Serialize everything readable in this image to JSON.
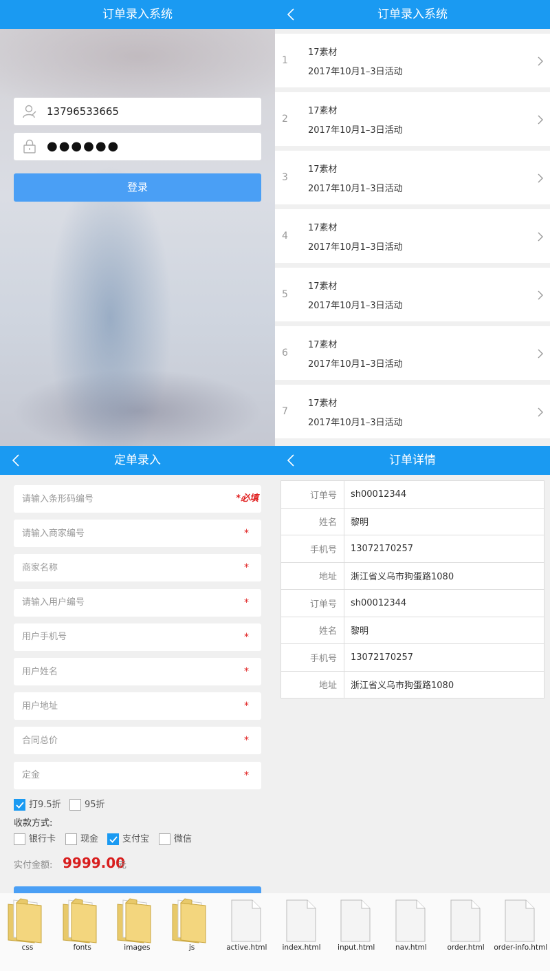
{
  "login": {
    "title": "订单录入系统",
    "phone": "13796533665",
    "password_mask": "●●●●●●",
    "login_button": "登录"
  },
  "list": {
    "title": "订单录入系统",
    "items": [
      {
        "num": "1",
        "title": "17素材",
        "sub": "2017年10月1–3日活动"
      },
      {
        "num": "2",
        "title": "17素材",
        "sub": "2017年10月1–3日活动"
      },
      {
        "num": "3",
        "title": "17素材",
        "sub": "2017年10月1–3日活动"
      },
      {
        "num": "4",
        "title": "17素材",
        "sub": "2017年10月1–3日活动"
      },
      {
        "num": "5",
        "title": "17素材",
        "sub": "2017年10月1–3日活动"
      },
      {
        "num": "6",
        "title": "17素材",
        "sub": "2017年10月1–3日活动"
      },
      {
        "num": "7",
        "title": "17素材",
        "sub": "2017年10月1–3日活动"
      }
    ]
  },
  "input": {
    "title": "定单录入",
    "fields": [
      {
        "placeholder": "请输入条形码编号",
        "mark": "*必填"
      },
      {
        "placeholder": "请输入商家编号",
        "mark": "*"
      },
      {
        "placeholder": "商家名称",
        "mark": "*"
      },
      {
        "placeholder": "请输入用户编号",
        "mark": "*"
      },
      {
        "placeholder": "用户手机号",
        "mark": "*"
      },
      {
        "placeholder": "用户姓名",
        "mark": "*"
      },
      {
        "placeholder": "用户地址",
        "mark": "*"
      },
      {
        "placeholder": "合同总价",
        "mark": "*"
      },
      {
        "placeholder": "定金",
        "mark": "*"
      }
    ],
    "discounts": [
      {
        "label": "打9.5折",
        "checked": true
      },
      {
        "label": "95折",
        "checked": false
      }
    ],
    "payment_label": "收款方式:",
    "payments": [
      {
        "label": "银行卡",
        "checked": false
      },
      {
        "label": "现金",
        "checked": false
      },
      {
        "label": "支付宝",
        "checked": true
      },
      {
        "label": "微信",
        "checked": false
      }
    ],
    "amount_label": "实付金额:",
    "amount_value": "9999.00",
    "amount_unit": "元"
  },
  "detail": {
    "title": "订单详情",
    "rows": [
      {
        "key": "订单号",
        "value": "sh00012344"
      },
      {
        "key": "姓名",
        "value": "黎明"
      },
      {
        "key": "手机号",
        "value": "13072170257"
      },
      {
        "key": "地址",
        "value": "浙江省义乌市狗蛋路1080"
      },
      {
        "key": "订单号",
        "value": "sh00012344"
      },
      {
        "key": "姓名",
        "value": "黎明"
      },
      {
        "key": "手机号",
        "value": "13072170257"
      },
      {
        "key": "地址",
        "value": "浙江省义乌市狗蛋路1080"
      }
    ]
  },
  "files": [
    {
      "name": "css",
      "kind": "folder-icon"
    },
    {
      "name": "fonts",
      "kind": "folder-icon"
    },
    {
      "name": "images",
      "kind": "folder-icon"
    },
    {
      "name": "js",
      "kind": "folder-icon"
    },
    {
      "name": "active.html",
      "kind": "file-icon"
    },
    {
      "name": "index.html",
      "kind": "file-icon"
    },
    {
      "name": "input.html",
      "kind": "file-icon"
    },
    {
      "name": "nav.html",
      "kind": "file-icon"
    },
    {
      "name": "order.html",
      "kind": "file-icon"
    },
    {
      "name": "order-info.html",
      "kind": "file-icon"
    }
  ],
  "colors": {
    "accent": "#1a9af2",
    "button": "#4a9ff5",
    "required": "#e02020",
    "amount": "#d81e1e"
  }
}
